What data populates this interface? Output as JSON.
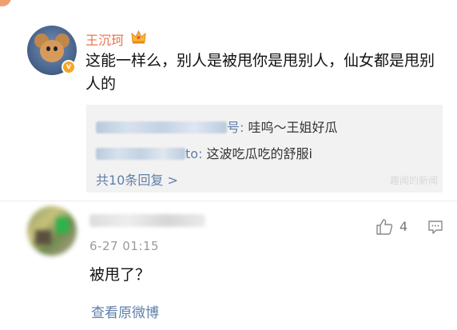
{
  "comment1": {
    "username": "王沉珂",
    "vip_icon": "crown-icon",
    "verified_icon": "v-badge-icon",
    "verified_mark": "v",
    "content": "这能一样么，别人是被甩你是甩别人，仙女都是甩别人的",
    "replies": [
      {
        "name_suffix": "号:",
        "text": " 哇呜～王姐好瓜"
      },
      {
        "name_suffix": "to:",
        "text": " 这波吃瓜吃的舒服i"
      }
    ],
    "more_replies": "共10条回复 >",
    "watermark": "趣闻的新闻"
  },
  "comment2": {
    "time": "6-27 01:15",
    "content": "被甩了？",
    "like_count": "4",
    "like_icon": "thumbs-up-icon",
    "comment_icon": "comment-icon"
  },
  "footer": {
    "view_original": "查看原微博"
  },
  "colors": {
    "accent_link": "#5e7fa9",
    "username": "#eb7350",
    "reply_bg": "#f2f2f2"
  }
}
